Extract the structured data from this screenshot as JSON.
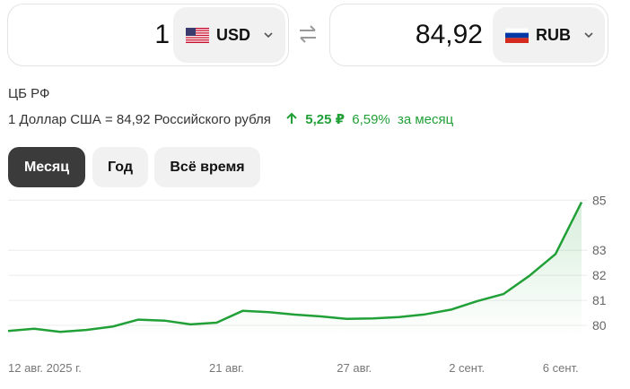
{
  "converter": {
    "from": {
      "amount": "1",
      "currency": "USD",
      "flag_icon": "us-flag-icon"
    },
    "to": {
      "amount": "84,92",
      "currency": "RUB",
      "flag_icon": "ru-flag-icon"
    },
    "swap_icon": "swap-arrows-icon"
  },
  "info": {
    "source": "ЦБ РФ",
    "rate_text": "1 Доллар США = 84,92 Российского рубля",
    "change_value": "5,25 ₽",
    "change_percent": "6,59%",
    "change_period": "за месяц",
    "trend_color": "#21a038"
  },
  "periods": [
    {
      "label": "Месяц",
      "active": true
    },
    {
      "label": "Год",
      "active": false
    },
    {
      "label": "Всё время",
      "active": false
    }
  ],
  "chart_data": {
    "type": "area",
    "x_tick_labels": [
      "12 авг. 2025 г.",
      "21 авг.",
      "27 авг.",
      "2 сент.",
      "6 сент."
    ],
    "y_tick_labels": [
      "85",
      "83",
      "82",
      "81",
      "80"
    ],
    "y_ticks": [
      85,
      83,
      82,
      81,
      80
    ],
    "ylim": [
      79.5,
      85.3
    ],
    "grid": true,
    "line_color": "#21a038",
    "series": [
      {
        "values": [
          79.78,
          79.87,
          79.74,
          79.82,
          79.95,
          80.23,
          80.19,
          80.04,
          80.11,
          80.58,
          80.53,
          80.43,
          80.36,
          80.26,
          80.28,
          80.33,
          80.44,
          80.63,
          80.97,
          81.25,
          81.98,
          82.85,
          84.92
        ]
      }
    ]
  }
}
